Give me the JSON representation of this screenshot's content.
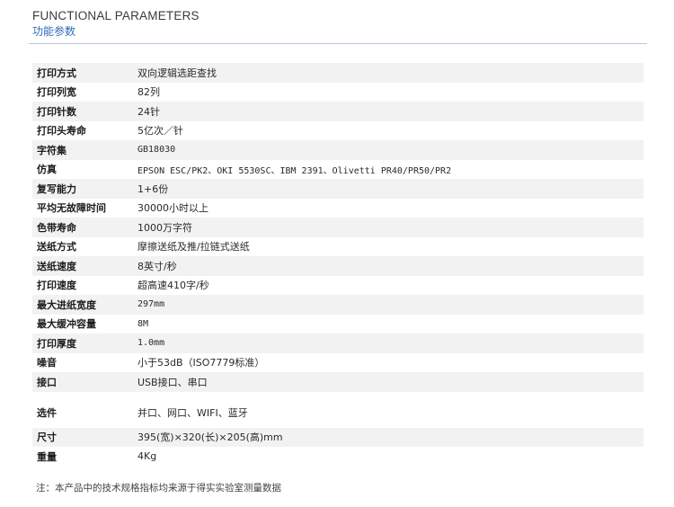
{
  "header": {
    "title_en": "FUNCTIONAL PARAMETERS",
    "title_cn": "功能参数"
  },
  "specs": [
    {
      "label": "打印方式",
      "value": "双向逻辑选距查找"
    },
    {
      "label": "打印列宽",
      "value": "82列"
    },
    {
      "label": "打印针数",
      "value": "24针"
    },
    {
      "label": "打印头寿命",
      "value": "5亿次／针"
    },
    {
      "label": "字符集",
      "value": "GB18030"
    },
    {
      "label": "仿真",
      "value": "EPSON ESC/PK2、OKI 5530SC、IBM 2391、Olivetti PR40/PR50/PR2"
    },
    {
      "label": "复写能力",
      "value": "1+6份"
    },
    {
      "label": "平均无故障时间",
      "value": "30000小时以上"
    },
    {
      "label": "色带寿命",
      "value": "1000万字符"
    },
    {
      "label": "送纸方式",
      "value": "摩擦送纸及推/拉链式送纸"
    },
    {
      "label": "送纸速度",
      "value": "8英寸/秒"
    },
    {
      "label": "打印速度",
      "value": "超高速410字/秒"
    },
    {
      "label": "最大进纸宽度",
      "value": "297mm"
    },
    {
      "label": "最大缓冲容量",
      "value": "8M"
    },
    {
      "label": "打印厚度",
      "value": "1.0mm"
    },
    {
      "label": "噪音",
      "value": "小于53dB（ISO7779标准）"
    },
    {
      "label": "接口",
      "value": "USB接口、串口"
    },
    {
      "label": "选件",
      "value": "并口、网口、WIFI、蓝牙"
    },
    {
      "label": "尺寸",
      "value": "395(宽)×320(长)×205(高)mm"
    },
    {
      "label": "重量",
      "value": "4Kg"
    }
  ],
  "footnote": "注：本产品中的技术规格指标均来源于得实实验室测量数据"
}
